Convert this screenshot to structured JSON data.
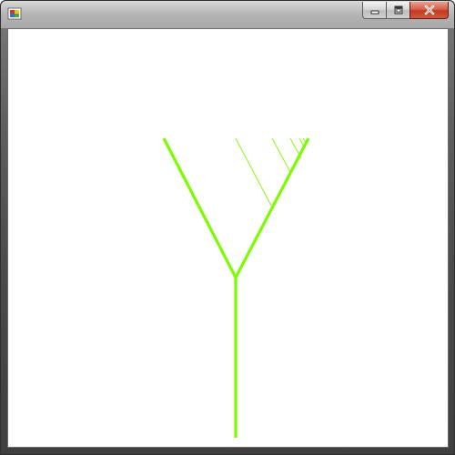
{
  "window": {
    "title": "",
    "controls": {
      "minimize_icon": "minimize-icon",
      "maximize_icon": "maximize-icon",
      "close_icon": "close-icon"
    }
  },
  "canvas": {
    "background": "#ffffff",
    "branch_color": "#7cfc00",
    "content": "fractal-tree"
  }
}
